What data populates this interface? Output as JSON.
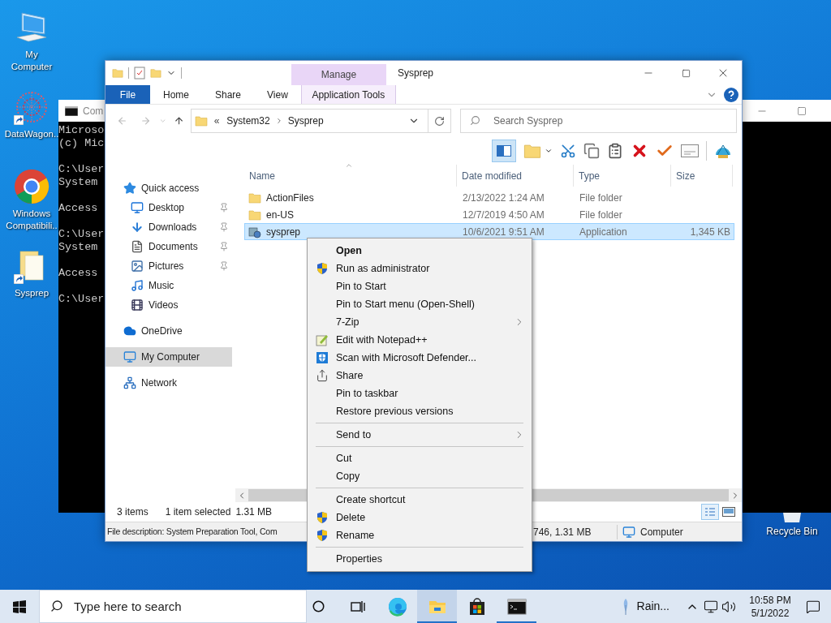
{
  "desktop": {
    "icons": [
      {
        "label": "My Computer",
        "kind": "computer",
        "shortcut": false
      },
      {
        "label": "DataWagon..",
        "kind": "network-graph",
        "shortcut": true
      },
      {
        "label": "Windows Compatibili..",
        "kind": "chrome",
        "shortcut": false
      },
      {
        "label": "Sysprep",
        "kind": "documents",
        "shortcut": true
      }
    ],
    "recycle_bin": {
      "label": "Recycle Bin"
    }
  },
  "console_window": {
    "title": "Com",
    "blocks": [
      [
        "Microso",
        "(c) Mic"
      ],
      [
        "C:\\User",
        "System"
      ],
      [
        "Access"
      ],
      [
        "C:\\User",
        "System"
      ],
      [
        "Access"
      ],
      [
        "C:\\User"
      ]
    ]
  },
  "explorer": {
    "contextual_group": "Manage",
    "title": "Sysprep",
    "ribbon_tabs": [
      {
        "label": "File",
        "kind": "file"
      },
      {
        "label": "Home",
        "kind": "normal"
      },
      {
        "label": "Share",
        "kind": "normal"
      },
      {
        "label": "View",
        "kind": "normal"
      },
      {
        "label": "Application Tools",
        "kind": "contextual"
      }
    ],
    "address": {
      "overflow": "«",
      "path": [
        "System32",
        "Sysprep"
      ]
    },
    "search": {
      "placeholder": "Search Sysprep"
    },
    "nav": [
      {
        "label": "Quick access",
        "kind": "star",
        "selected": false,
        "children": [
          {
            "label": "Desktop",
            "kind": "desktop",
            "pinned": true
          },
          {
            "label": "Downloads",
            "kind": "download",
            "pinned": true
          },
          {
            "label": "Documents",
            "kind": "document",
            "pinned": true
          },
          {
            "label": "Pictures",
            "kind": "picture",
            "pinned": true
          },
          {
            "label": "Music",
            "kind": "music",
            "pinned": false
          },
          {
            "label": "Videos",
            "kind": "video",
            "pinned": false
          }
        ]
      },
      {
        "label": "OneDrive",
        "kind": "cloud",
        "selected": false
      },
      {
        "label": "My Computer",
        "kind": "computer",
        "selected": true
      },
      {
        "label": "Network",
        "kind": "network",
        "selected": false
      }
    ],
    "columns": [
      "Name",
      "Date modified",
      "Type",
      "Size"
    ],
    "rows": [
      {
        "name": "ActionFiles",
        "date": "2/13/2022 1:24 AM",
        "type": "File folder",
        "kind": "folder",
        "selected": false
      },
      {
        "name": "en-US",
        "date": "12/7/2019 4:50 AM",
        "type": "File folder",
        "kind": "folder",
        "selected": false
      },
      {
        "name": "sysprep",
        "date": "10/6/2021 9:51 AM",
        "type": "Application",
        "size": "1,345 KB",
        "kind": "application",
        "selected": true
      }
    ],
    "status": {
      "count": "3 items",
      "selection": "1 item selected",
      "size": "1.31 MB"
    },
    "info_bar": {
      "description": "File description: System Preparation Tool, Com",
      "details": "746, 1.31 MB",
      "zone": "Computer"
    }
  },
  "context_menu": {
    "groups": [
      [
        {
          "label": "Open",
          "kind": "plain",
          "default": true,
          "submenu": false
        },
        {
          "label": "Run as administrator",
          "kind": "shield",
          "default": false,
          "submenu": false
        },
        {
          "label": "Pin to Start",
          "kind": "plain",
          "default": false,
          "submenu": false
        },
        {
          "label": "Pin to Start menu (Open-Shell)",
          "kind": "plain",
          "default": false,
          "submenu": false
        },
        {
          "label": "7-Zip",
          "kind": "plain",
          "default": false,
          "submenu": true
        },
        {
          "label": "Edit with Notepad++",
          "kind": "notepad",
          "default": false,
          "submenu": false
        },
        {
          "label": "Scan with Microsoft Defender...",
          "kind": "defender",
          "default": false,
          "submenu": false
        },
        {
          "label": "Share",
          "kind": "share",
          "default": false,
          "submenu": false
        },
        {
          "label": "Pin to taskbar",
          "kind": "plain",
          "default": false,
          "submenu": false
        },
        {
          "label": "Restore previous versions",
          "kind": "plain",
          "default": false,
          "submenu": false
        }
      ],
      [
        {
          "label": "Send to",
          "kind": "plain",
          "default": false,
          "submenu": true
        }
      ],
      [
        {
          "label": "Cut",
          "kind": "plain",
          "default": false,
          "submenu": false
        },
        {
          "label": "Copy",
          "kind": "plain",
          "default": false,
          "submenu": false
        }
      ],
      [
        {
          "label": "Create shortcut",
          "kind": "plain",
          "default": false,
          "submenu": false
        },
        {
          "label": "Delete",
          "kind": "shield",
          "default": false,
          "submenu": false
        },
        {
          "label": "Rename",
          "kind": "shield",
          "default": false,
          "submenu": false
        }
      ],
      [
        {
          "label": "Properties",
          "kind": "plain",
          "default": false,
          "submenu": false
        }
      ]
    ]
  },
  "taskbar": {
    "search_placeholder": "Type here to search",
    "apps": [
      {
        "kind": "edge",
        "selected": false,
        "running": false
      },
      {
        "kind": "explorer",
        "selected": true,
        "running": true
      },
      {
        "kind": "store",
        "selected": false,
        "running": false
      },
      {
        "kind": "console",
        "selected": false,
        "running": true
      }
    ],
    "weather": "Rain...",
    "time": "10:58 PM",
    "date": "5/1/2022"
  }
}
